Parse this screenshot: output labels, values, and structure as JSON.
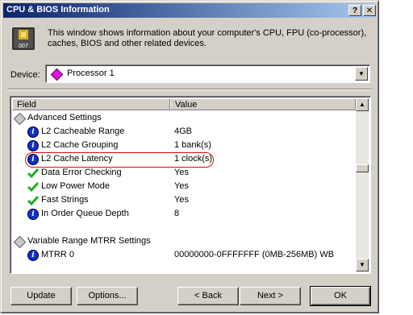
{
  "window": {
    "title": "CPU & BIOS Information",
    "help_symbol": "?",
    "close_symbol": "✕"
  },
  "header": {
    "icon_label": "007",
    "description": "This window shows information about your computer's CPU, FPU (co-processor), caches, BIOS and other related devices."
  },
  "device": {
    "label": "Device:",
    "selected": "Processor 1"
  },
  "list": {
    "columns": [
      "Field",
      "Value"
    ],
    "rows": [
      {
        "type": "group",
        "field": "Advanced Settings",
        "value": ""
      },
      {
        "type": "info",
        "field": "L2 Cacheable Range",
        "value": "4GB"
      },
      {
        "type": "info",
        "field": "L2 Cache Grouping",
        "value": "1 bank(s)"
      },
      {
        "type": "info",
        "field": "L2 Cache Latency",
        "value": "1 clock(s)",
        "highlighted": true
      },
      {
        "type": "check",
        "field": "Data Error Checking",
        "value": "Yes"
      },
      {
        "type": "check",
        "field": "Low Power Mode",
        "value": "Yes"
      },
      {
        "type": "check",
        "field": "Fast Strings",
        "value": "Yes"
      },
      {
        "type": "info",
        "field": "In Order Queue Depth",
        "value": "8"
      },
      {
        "type": "blank",
        "field": "",
        "value": ""
      },
      {
        "type": "group",
        "field": "Variable Range MTRR Settings",
        "value": ""
      },
      {
        "type": "info",
        "field": "MTRR 0",
        "value": "00000000-0FFFFFFF (0MB-256MB) WB"
      }
    ]
  },
  "buttons": {
    "update": "Update",
    "options": "Options...",
    "back": "< Back",
    "next": "Next >",
    "ok": "OK"
  },
  "colors": {
    "title_start": "#0a246a",
    "title_end": "#a6caf0",
    "highlight": "#cc1010",
    "info_icon": "#1030c8",
    "check_icon": "#20b020"
  }
}
